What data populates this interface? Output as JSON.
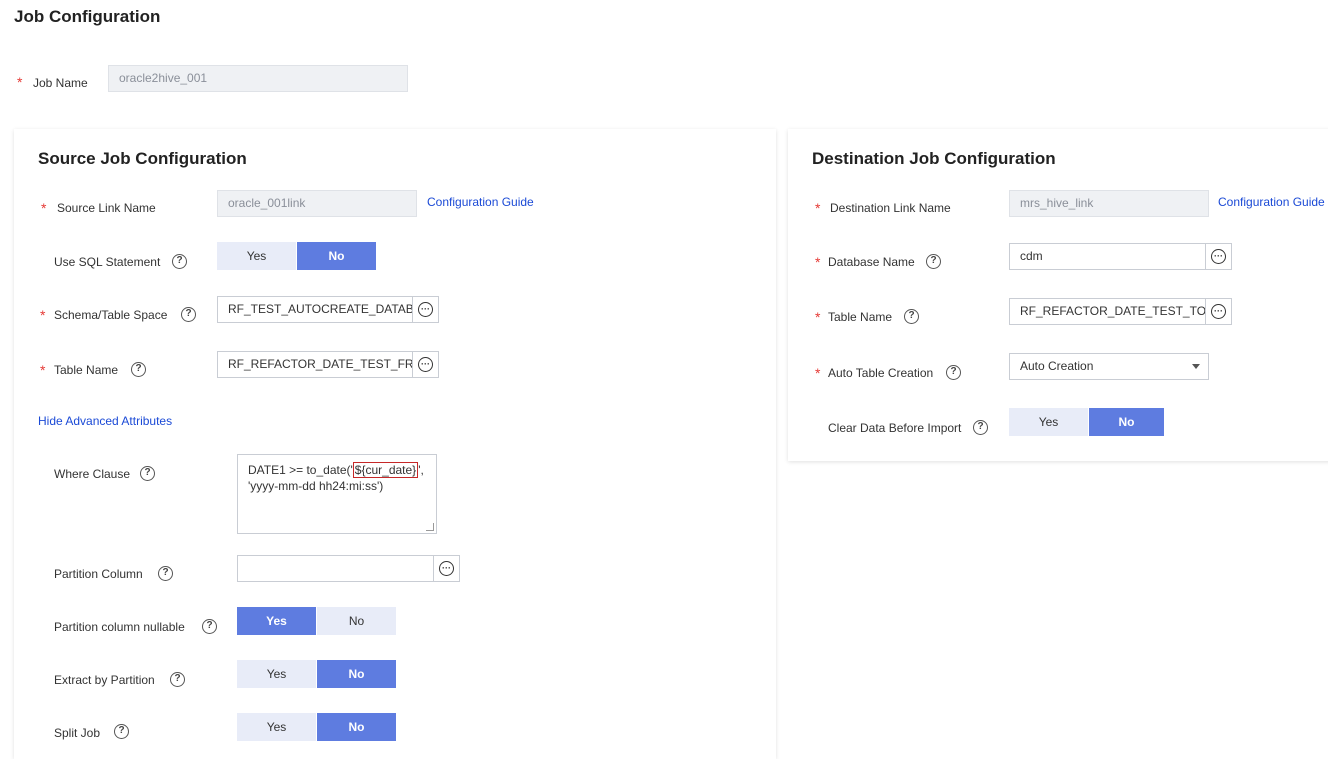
{
  "page_title": "Job Configuration",
  "job_name": {
    "label": "Job Name",
    "value": "oracle2hive_001"
  },
  "source": {
    "title": "Source Job Configuration",
    "link_name": {
      "label": "Source Link Name",
      "value": "oracle_001link",
      "guide": "Configuration Guide"
    },
    "use_sql": {
      "label": "Use SQL Statement",
      "options": [
        "Yes",
        "No"
      ],
      "selected": "No"
    },
    "schema": {
      "label": "Schema/Table Space",
      "value": "RF_TEST_AUTOCREATE_DATABA"
    },
    "table": {
      "label": "Table Name",
      "value": "RF_REFACTOR_DATE_TEST_FRO"
    },
    "advanced_link": "Hide Advanced Attributes",
    "where": {
      "label": "Where Clause",
      "prefix": "DATE1 >= to_date('",
      "highlight": "${cur_date}",
      "suffix": "',",
      "line2": "'yyyy-mm-dd hh24:mi:ss')"
    },
    "partition_column": {
      "label": "Partition Column",
      "value": ""
    },
    "partition_nullable": {
      "label": "Partition column nullable",
      "options": [
        "Yes",
        "No"
      ],
      "selected": "Yes"
    },
    "extract_by_partition": {
      "label": "Extract by Partition",
      "options": [
        "Yes",
        "No"
      ],
      "selected": "No"
    },
    "split_job": {
      "label": "Split Job",
      "options": [
        "Yes",
        "No"
      ],
      "selected": "No"
    }
  },
  "destination": {
    "title": "Destination Job Configuration",
    "link_name": {
      "label": "Destination Link Name",
      "value": "mrs_hive_link",
      "guide": "Configuration Guide"
    },
    "database": {
      "label": "Database Name",
      "value": "cdm"
    },
    "table": {
      "label": "Table Name",
      "value": "RF_REFACTOR_DATE_TEST_TO"
    },
    "auto_create": {
      "label": "Auto Table Creation",
      "value": "Auto Creation"
    },
    "clear_data": {
      "label": "Clear Data Before Import",
      "options": [
        "Yes",
        "No"
      ],
      "selected": "No"
    }
  },
  "help_glyph": "?",
  "browse_glyph": "···",
  "colors": {
    "accent": "#5e7ce0",
    "toggle_off": "#e8ecf8",
    "link": "#1b4ad6",
    "required": "#e53935"
  }
}
